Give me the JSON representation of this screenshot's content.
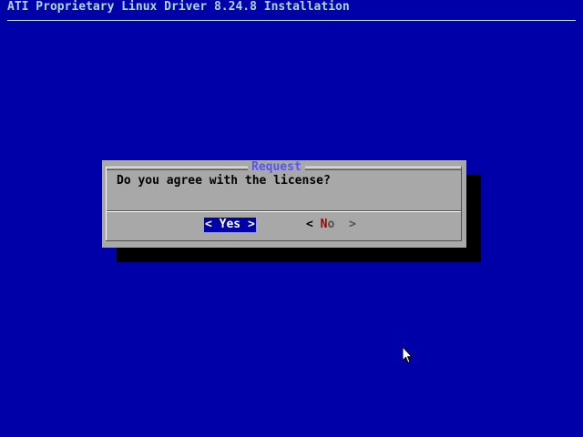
{
  "backtitle": "ATI Proprietary Linux Driver 8.24.8 Installation",
  "dialog": {
    "title": "Request",
    "message": "Do you agree with the license?",
    "buttons": {
      "yes": {
        "open": "<",
        "hotkey": "Y",
        "rest": "es",
        "close": ">",
        "selected": true
      },
      "no": {
        "open": "<",
        "hotkey": "N",
        "rest": "o",
        "close": ">",
        "selected": false
      }
    }
  },
  "colors": {
    "background": "#0000a8",
    "dialog": "#a8a8a8",
    "title": "#5454fc",
    "backtitle": "#a8d8ff",
    "hotkey": "#a80000"
  },
  "icons": {
    "pointer": "mouse-pointer-icon"
  }
}
